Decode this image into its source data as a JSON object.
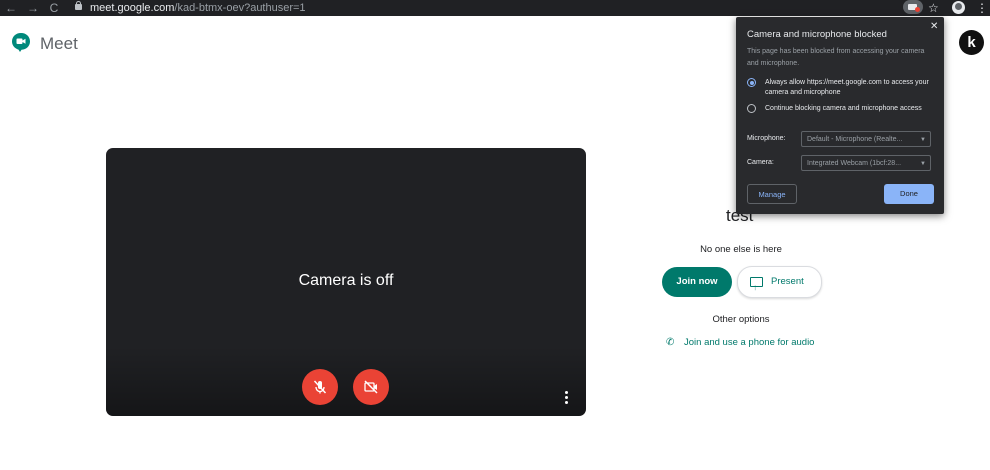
{
  "browser": {
    "back_icon": "←",
    "forward_icon": "→",
    "reload_icon": "C",
    "url_host": "meet.google.com",
    "url_path": "/kad-btmx-oev?authuser=1",
    "star_icon": "☆",
    "menu_icon": "⋮"
  },
  "header": {
    "app_name": "Meet",
    "avatar_letter": "k"
  },
  "preview": {
    "camera_status": "Camera is off"
  },
  "join_panel": {
    "meeting_title": "test",
    "participants_status": "No one else is here",
    "join_label": "Join now",
    "present_label": "Present",
    "other_options_label": "Other options",
    "phone_link_label": "Join and use a phone for audio"
  },
  "permission_popup": {
    "title": "Camera and microphone blocked",
    "description": "This page has been blocked from accessing your camera and microphone.",
    "option_allow": "Always allow https://meet.google.com to access your camera and microphone",
    "option_block": "Continue blocking camera and microphone access",
    "selected_option": "allow",
    "microphone_label": "Microphone:",
    "microphone_value": "Default - Microphone (Realte...",
    "camera_label": "Camera:",
    "camera_value": "Integrated Webcam (1bcf:28...",
    "manage_label": "Manage",
    "done_label": "Done",
    "close_icon": "✕"
  },
  "colors": {
    "accent_green": "#00796b",
    "danger_red": "#ea4335",
    "link_blue": "#8ab4f8",
    "dark_surface": "#202124"
  }
}
